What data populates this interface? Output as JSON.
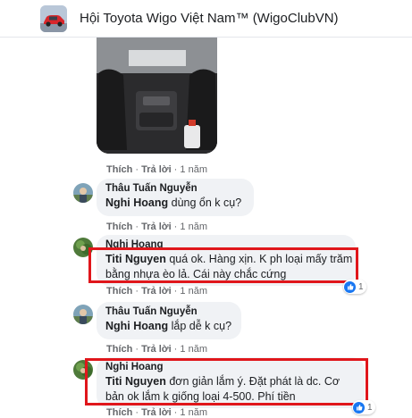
{
  "header": {
    "group_name": "Hội Toyota Wigo Việt Nam™ (WigoClubVN)"
  },
  "action_labels": {
    "like": "Thích",
    "reply": "Trả lời"
  },
  "comments": [
    {
      "actions": {
        "time": "1 năm"
      }
    },
    {
      "author": "Thâu Tuấn Nguyễn",
      "mention": "Nghi Hoang",
      "text": " dùng ổn k cụ?",
      "actions": {
        "time": "1 năm"
      }
    },
    {
      "author": "Nghi Hoang",
      "mention": "Titi Nguyen",
      "lines": [
        " quá ok. Hàng xịn. K ph loại mấy trăm",
        "bằng nhựa èo lả. Cái này chắc cứng"
      ],
      "reactions": "1",
      "actions": {
        "time": "1 năm"
      }
    },
    {
      "author": "Thâu Tuấn Nguyễn",
      "mention": "Nghi Hoang",
      "text": " lắp dễ k cụ?",
      "actions": {
        "time": "1 năm"
      }
    },
    {
      "author": "Nghi Hoang",
      "mention": "Titi Nguyen",
      "lines": [
        " đơn giản lắm ý. Đặt phát là dc. Cơ",
        "bản ok lắm k giống loại 4-500. Phí tiền"
      ],
      "reactions": "1",
      "actions": {
        "time": "1 năm"
      }
    }
  ],
  "colors": {
    "highlight_box": "#e0161b",
    "bubble": "#f0f2f5",
    "like_blue": "#1877f2"
  }
}
